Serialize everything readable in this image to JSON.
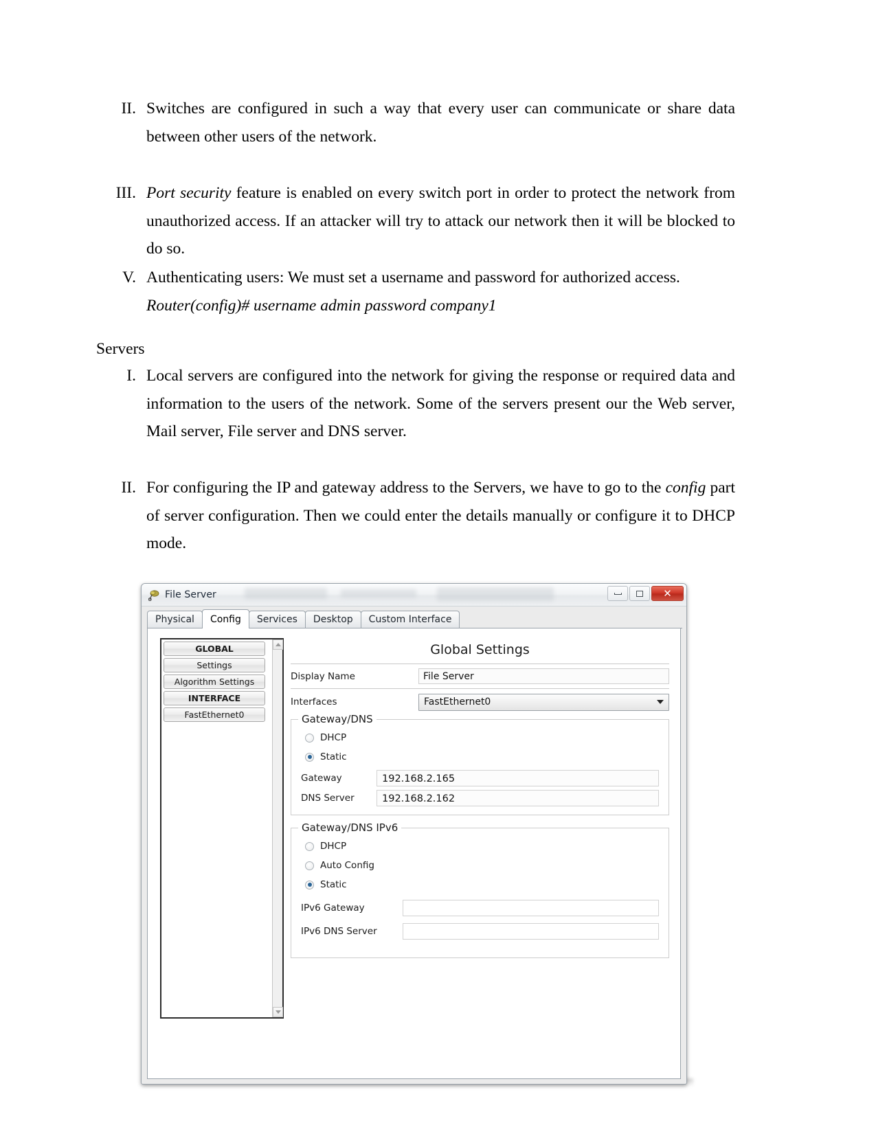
{
  "document": {
    "items": [
      {
        "marker": "II.",
        "text": "Switches are configured in such a way that every user can communicate or share data between other users of the network."
      },
      {
        "marker": "III.",
        "text_italic": "Port security",
        "text": " feature is enabled on every switch port in order to protect the network from unauthorized access. If an attacker will try to attack our network then it will be blocked to do so."
      },
      {
        "marker": "V.",
        "text": "Authenticating users: We must set a username and password for authorized access.",
        "command": "Router(config)# username admin password company1"
      }
    ],
    "section_heading": "Servers",
    "server_items": [
      {
        "marker": "I.",
        "text": "Local servers are configured into the network for giving the response or required data and information to the users of the network. Some of the servers present our the Web server, Mail server, File server and DNS server."
      },
      {
        "marker": "II.",
        "text_before": "For configuring the IP and gateway address to the Servers, we have to go to the ",
        "text_italic": "config",
        "text_after": " part of server configuration. Then we could enter the details manually or configure it to DHCP mode."
      }
    ]
  },
  "window": {
    "title": "File Server",
    "icon": "packet-tracer-server-icon",
    "buttons": {
      "minimize": "–",
      "maximize": "□",
      "close": "✕"
    },
    "tabs": [
      {
        "label": "Physical",
        "active": false
      },
      {
        "label": "Config",
        "active": true
      },
      {
        "label": "Services",
        "active": false
      },
      {
        "label": "Desktop",
        "active": false
      },
      {
        "label": "Custom Interface",
        "active": false
      }
    ],
    "sidebar": [
      {
        "label": "GLOBAL",
        "section": true
      },
      {
        "label": "Settings",
        "section": false
      },
      {
        "label": "Algorithm Settings",
        "section": false
      },
      {
        "label": "INTERFACE",
        "section": true
      },
      {
        "label": "FastEthernet0",
        "section": false
      }
    ],
    "settings": {
      "title": "Global Settings",
      "display_name_label": "Display Name",
      "display_name_value": "File Server",
      "interfaces_label": "Interfaces",
      "interfaces_value": "FastEthernet0",
      "gateway_dns": {
        "title": "Gateway/DNS",
        "options": [
          {
            "label": "DHCP",
            "checked": false
          },
          {
            "label": "Static",
            "checked": true
          }
        ],
        "gateway_label": "Gateway",
        "gateway_value": "192.168.2.165",
        "dns_label": "DNS Server",
        "dns_value": "192.168.2.162"
      },
      "gateway_dns_ipv6": {
        "title": "Gateway/DNS IPv6",
        "options": [
          {
            "label": "DHCP",
            "checked": false
          },
          {
            "label": "Auto Config",
            "checked": false
          },
          {
            "label": "Static",
            "checked": true
          }
        ],
        "gateway_label": "IPv6 Gateway",
        "gateway_value": "",
        "dns_label": "IPv6 DNS Server",
        "dns_value": ""
      }
    }
  }
}
